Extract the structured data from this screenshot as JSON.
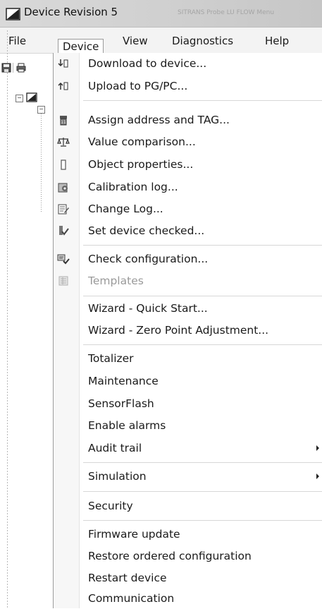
{
  "window": {
    "title": "Device Revision 5",
    "ghost_title": "SITRANS Probe LU FLOW Menu"
  },
  "menubar": {
    "items": [
      "File",
      "Device",
      "View",
      "Diagnostics",
      "Help"
    ],
    "active": "Device"
  },
  "menu": {
    "items": [
      {
        "label": "Download to device...",
        "icon": "download-icon"
      },
      {
        "label": "Upload to PG/PC...",
        "icon": "upload-icon"
      },
      {
        "label": "Assign address and TAG...",
        "icon": "tag-icon"
      },
      {
        "label": "Value comparison...",
        "icon": "scale-icon"
      },
      {
        "label": "Object properties...",
        "icon": "properties-icon"
      },
      {
        "label": "Calibration log...",
        "icon": "calibration-log-icon"
      },
      {
        "label": "Change Log...",
        "icon": "change-log-icon"
      },
      {
        "label": "Set device checked...",
        "icon": "check-device-icon"
      },
      {
        "label": "Check configuration...",
        "icon": "check-config-icon"
      },
      {
        "label": "Templates",
        "icon": "templates-icon",
        "disabled": true
      },
      {
        "label": "Wizard - Quick Start..."
      },
      {
        "label": "Wizard - Zero Point Adjustment..."
      },
      {
        "label": "Totalizer"
      },
      {
        "label": "Maintenance"
      },
      {
        "label": "SensorFlash"
      },
      {
        "label": "Enable alarms"
      },
      {
        "label": "Audit trail",
        "submenu": true
      },
      {
        "label": "Simulation",
        "submenu": true
      },
      {
        "label": "Security"
      },
      {
        "label": "Firmware update"
      },
      {
        "label": "Restore ordered configuration"
      },
      {
        "label": "Restart device"
      },
      {
        "label": "Communication"
      }
    ]
  },
  "colors": {
    "menu_bg": "#ffffff",
    "disabled_text": "#9a9a9a",
    "title_bg": "#d9d9d9"
  }
}
